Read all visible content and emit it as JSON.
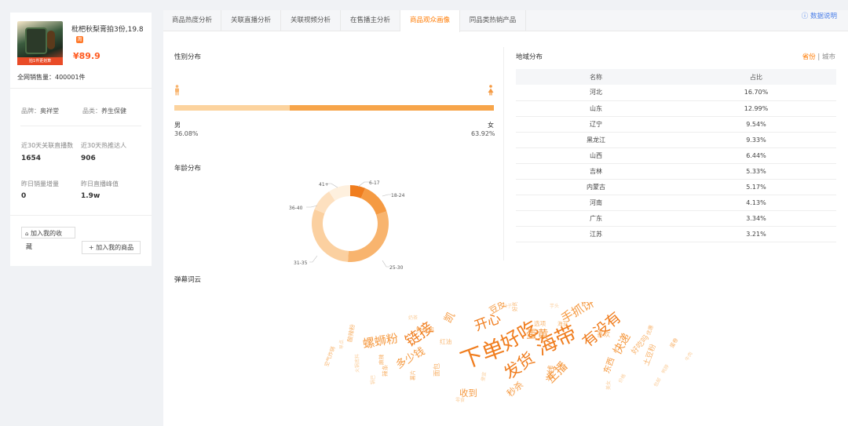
{
  "product": {
    "title": "枇杷秋梨膏拍3份,19.8",
    "shop_badge": "淘",
    "price": "¥89.9",
    "image_tag": "拍1件更划算",
    "sales": "全网销售量：400001件"
  },
  "info": {
    "brand_label": "品牌：",
    "brand": "奥祥堂",
    "category_label": "品类：",
    "category": "养生保健",
    "stat1_label": "近30天关联直播数",
    "stat1_value": "1654",
    "stat2_label": "近30天热推达人",
    "stat2_value": "906",
    "stat3_label": "昨日销量增量",
    "stat3_value": "0",
    "stat4_label": "昨日直播峰值",
    "stat4_value": "1.9w"
  },
  "buttons": {
    "favorite_line1": "加入我的收",
    "favorite_line2": "藏",
    "add_product": "加入我的商品"
  },
  "tabs": [
    {
      "label": "商品热度分析"
    },
    {
      "label": "关联直播分析"
    },
    {
      "label": "关联视频分析"
    },
    {
      "label": "在售播主分析"
    },
    {
      "label": "商品观众画像"
    },
    {
      "label": "同品类热销产品"
    }
  ],
  "help": "数据说明",
  "gender": {
    "title": "性别分布",
    "male_label": "男",
    "male_pct": "36.08%",
    "male_fraction": 0.3608,
    "female_label": "女",
    "female_pct": "63.92%"
  },
  "age": {
    "title": "年龄分布",
    "labels": [
      "6-17",
      "18-24",
      "25-30",
      "31-35",
      "36-40",
      "41+"
    ]
  },
  "region": {
    "title": "地域分布",
    "toggle_province": "省份",
    "toggle_sep": " | ",
    "toggle_city": "城市",
    "col_name": "名称",
    "col_pct": "占比",
    "rows": [
      {
        "name": "河北",
        "pct": "16.70%"
      },
      {
        "name": "山东",
        "pct": "12.99%"
      },
      {
        "name": "辽宁",
        "pct": "9.54%"
      },
      {
        "name": "黑龙江",
        "pct": "9.33%"
      },
      {
        "name": "山西",
        "pct": "6.44%"
      },
      {
        "name": "吉林",
        "pct": "5.33%"
      },
      {
        "name": "内蒙古",
        "pct": "5.17%"
      },
      {
        "name": "河南",
        "pct": "4.13%"
      },
      {
        "name": "广东",
        "pct": "3.34%"
      },
      {
        "name": "江苏",
        "pct": "3.21%"
      }
    ]
  },
  "wordcloud": {
    "title": "弹幕词云",
    "words": [
      {
        "t": "下单",
        "s": 30
      },
      {
        "t": "好吃",
        "s": 26
      },
      {
        "t": "海带",
        "s": 28
      },
      {
        "t": "发货",
        "s": 22
      },
      {
        "t": "有没有",
        "s": 20
      },
      {
        "t": "链接",
        "s": 20
      },
      {
        "t": "开心",
        "s": 18
      },
      {
        "t": "螺蛳粉",
        "s": 16
      },
      {
        "t": "主播",
        "s": 16
      },
      {
        "t": "手抓饼",
        "s": 16
      },
      {
        "t": "蛋黄",
        "s": 15
      },
      {
        "t": "快递",
        "s": 15
      },
      {
        "t": "多少钱",
        "s": 14
      },
      {
        "t": "凯",
        "s": 14
      },
      {
        "t": "豆皮",
        "s": 12
      },
      {
        "t": "收到",
        "s": 12
      },
      {
        "t": "秒杀",
        "s": 12
      },
      {
        "t": "米线",
        "s": 11
      },
      {
        "t": "东西",
        "s": 11
      },
      {
        "t": "好吃吗",
        "s": 10
      },
      {
        "t": "喜欢",
        "s": 9
      },
      {
        "t": "土豆粉",
        "s": 10
      },
      {
        "t": "粉丝团",
        "s": 8
      },
      {
        "t": "红油",
        "s": 8
      },
      {
        "t": "面包",
        "s": 9
      },
      {
        "t": "选项",
        "s": 8
      },
      {
        "t": "海苔",
        "s": 7
      },
      {
        "t": "酸辣粉",
        "s": 8
      },
      {
        "t": "辣条",
        "s": 8
      },
      {
        "t": "薯片",
        "s": 7
      },
      {
        "t": "好的",
        "s": 7
      },
      {
        "t": "优惠",
        "s": 7
      },
      {
        "t": "蛋卷",
        "s": 7
      },
      {
        "t": "麻辣",
        "s": 7
      },
      {
        "t": "空气炸锅",
        "s": 7
      },
      {
        "t": "火锅底料",
        "s": 6
      },
      {
        "t": "牛肉",
        "s": 6
      },
      {
        "t": "鸭脖",
        "s": 6
      },
      {
        "t": "锅巴",
        "s": 6
      },
      {
        "t": "零食",
        "s": 6
      },
      {
        "t": "公子",
        "s": 6
      },
      {
        "t": "芋头",
        "s": 6
      },
      {
        "t": "价格",
        "s": 6
      },
      {
        "t": "包邮",
        "s": 6
      },
      {
        "t": "早点",
        "s": 6
      },
      {
        "t": "美女",
        "s": 6
      },
      {
        "t": "便宜",
        "s": 6
      },
      {
        "t": "奶茶",
        "s": 6
      }
    ]
  },
  "colors": {
    "accent": "#ff7a00",
    "wc1": "#f07d1e",
    "wc2": "#f59a42",
    "wc3": "#f8b46e",
    "wc4": "#fbd0a0"
  }
}
